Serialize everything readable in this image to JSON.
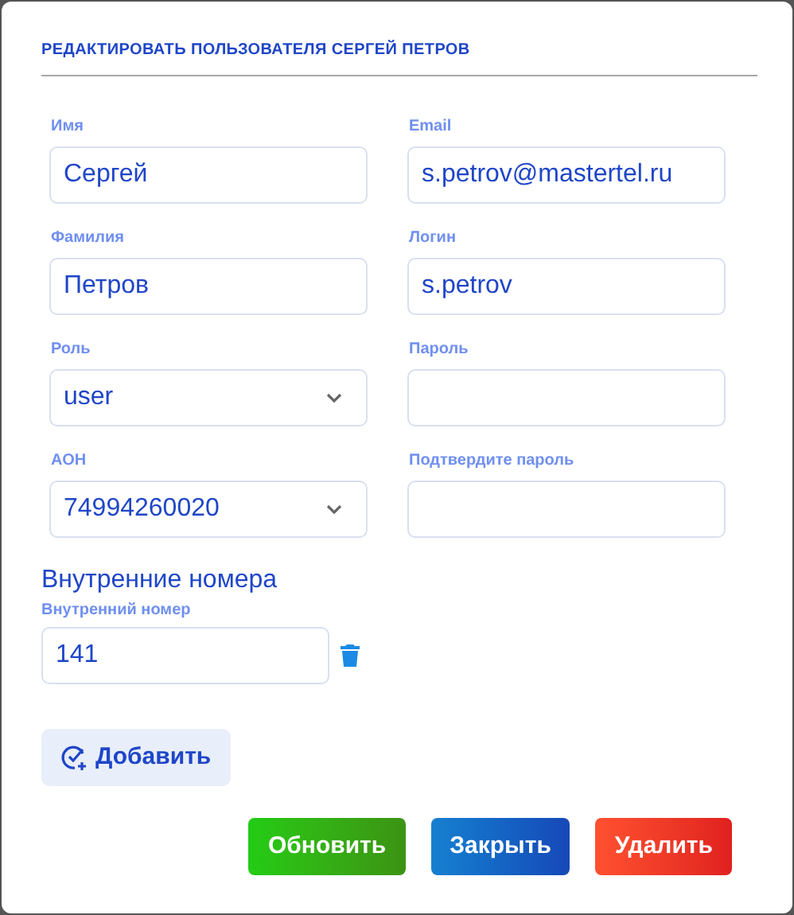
{
  "dialog": {
    "title": "РЕДАКТИРОВАТЬ ПОЛЬЗОВАТЕЛЯ СЕРГЕЙ ПЕТРОВ"
  },
  "fields": [
    {
      "label": "Имя",
      "kind": "text",
      "value": "Сергей"
    },
    {
      "label": "Email",
      "kind": "text",
      "value": "s.petrov@mastertel.ru"
    },
    {
      "label": "Фамилия",
      "kind": "text",
      "value": "Петров"
    },
    {
      "label": "Логин",
      "kind": "text",
      "value": "s.petrov"
    },
    {
      "label": "Роль",
      "kind": "select",
      "value": "user"
    },
    {
      "label": "Пароль",
      "kind": "password"
    },
    {
      "label": "АОН",
      "kind": "select",
      "value": "74994260020"
    },
    {
      "label": "Подтвердите пароль",
      "kind": "password"
    }
  ],
  "extensions": {
    "heading": "Внутренние номера",
    "items": [
      {
        "label": "Внутренний номер",
        "value": "141"
      }
    ],
    "add_button": "Добавить"
  },
  "buttons": [
    {
      "label": "Обновить",
      "kind": "success"
    },
    {
      "label": "Закрыть",
      "kind": "primary"
    },
    {
      "label": "Удалить",
      "kind": "danger"
    }
  ]
}
